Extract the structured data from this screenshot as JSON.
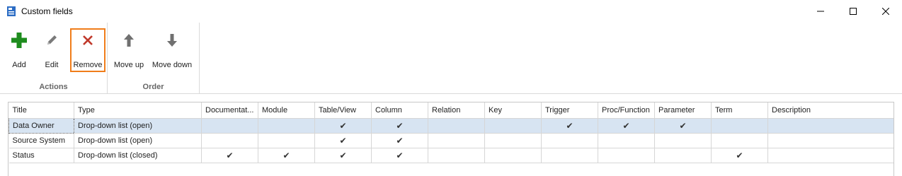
{
  "window": {
    "title": "Custom fields"
  },
  "ribbon": {
    "groups": [
      {
        "label": "Actions",
        "buttons": [
          {
            "label": "Add",
            "icon": "add-icon"
          },
          {
            "label": "Edit",
            "icon": "pencil-icon"
          },
          {
            "label": "Remove",
            "icon": "remove-icon"
          }
        ]
      },
      {
        "label": "Order",
        "buttons": [
          {
            "label": "Move up",
            "icon": "arrow-up-icon"
          },
          {
            "label": "Move down",
            "icon": "arrow-down-icon"
          }
        ]
      }
    ]
  },
  "grid": {
    "columns": [
      "Title",
      "Type",
      "Documentat...",
      "Module",
      "Table/View",
      "Column",
      "Relation",
      "Key",
      "Trigger",
      "Proc/Function",
      "Parameter",
      "Term",
      "Description"
    ],
    "check_glyph": "✔",
    "rows": [
      {
        "title": "Data Owner",
        "type": "Drop-down list (open)",
        "checks": [
          false,
          false,
          true,
          true,
          false,
          false,
          true,
          true,
          true,
          false
        ],
        "description": "",
        "selected": true
      },
      {
        "title": "Source System",
        "type": "Drop-down list (open)",
        "checks": [
          false,
          false,
          true,
          true,
          false,
          false,
          false,
          false,
          false,
          false
        ],
        "description": "",
        "selected": false
      },
      {
        "title": "Status",
        "type": "Drop-down list (closed)",
        "checks": [
          true,
          true,
          true,
          true,
          false,
          false,
          false,
          false,
          false,
          true
        ],
        "description": "",
        "selected": false
      }
    ]
  },
  "colors": {
    "add_green": "#1e8c1e",
    "remove_red": "#c0392b",
    "highlight_orange": "#f07d1a",
    "selected_row": "#d7e4f2"
  }
}
